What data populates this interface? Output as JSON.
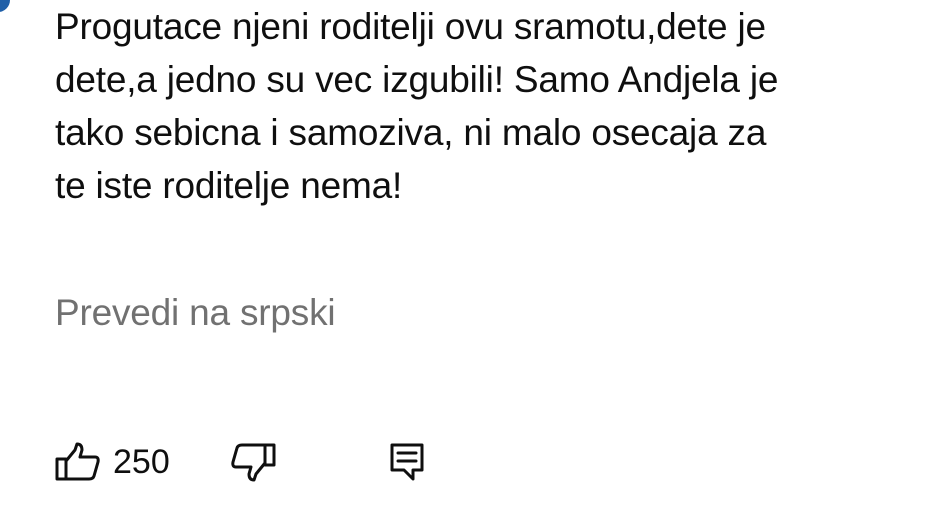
{
  "comment": {
    "lines": [
      "Progutace njeni roditelji ovu sramotu,dete je",
      "dete,a jedno su vec izgubili! Samo Andjela je",
      "tako sebicna i samoziva, ni malo osecaja za",
      "te iste roditelje nema!"
    ]
  },
  "translate": {
    "label": "Prevedi na srpski"
  },
  "actions": {
    "like_icon": "thumbs-up-icon",
    "like_count": "250",
    "dislike_icon": "thumbs-down-icon",
    "reply_icon": "reply-comment-icon"
  },
  "colors": {
    "text": "#0f0f0f",
    "secondary_text": "#717171",
    "avatar_edge": "#1f5fa8"
  }
}
